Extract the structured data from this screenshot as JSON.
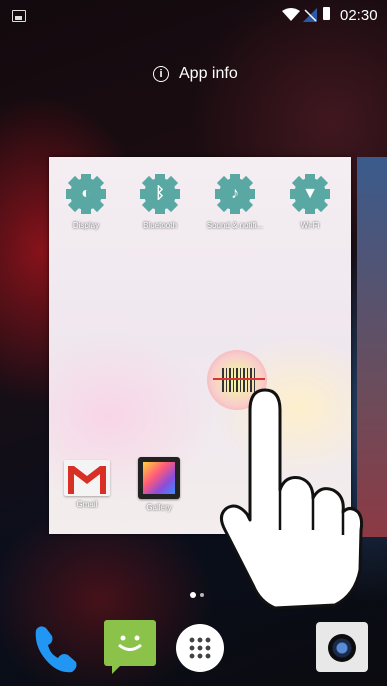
{
  "status_bar": {
    "time": "02:30",
    "icons": [
      "notification-image-icon",
      "wifi-icon",
      "no-sim-signal-icon",
      "battery-icon"
    ]
  },
  "app_info": {
    "label": "App info",
    "icon": "info-icon"
  },
  "widget_panel": {
    "settings_shortcuts": [
      {
        "label": "Display",
        "icon": "display-icon"
      },
      {
        "label": "Bluetooth",
        "icon": "bluetooth-icon"
      },
      {
        "label": "Sound & notifi...",
        "icon": "bell-icon"
      },
      {
        "label": "Wi-Fi",
        "icon": "wifi-icon"
      }
    ],
    "apps": [
      {
        "label": "Gmail",
        "icon": "gmail-icon"
      },
      {
        "label": "Gallery",
        "icon": "gallery-icon"
      }
    ]
  },
  "dock": {
    "apps": [
      {
        "name": "Phone",
        "icon": "phone-icon"
      },
      {
        "name": "Messaging",
        "icon": "messaging-icon"
      },
      {
        "name": "Apps",
        "icon": "app-drawer-icon"
      },
      {
        "name": "Camera",
        "icon": "camera-icon"
      }
    ]
  },
  "colors": {
    "settings_icon": "#5aa8a3",
    "messaging": "#8bc34a",
    "phone": "#2196f3"
  }
}
